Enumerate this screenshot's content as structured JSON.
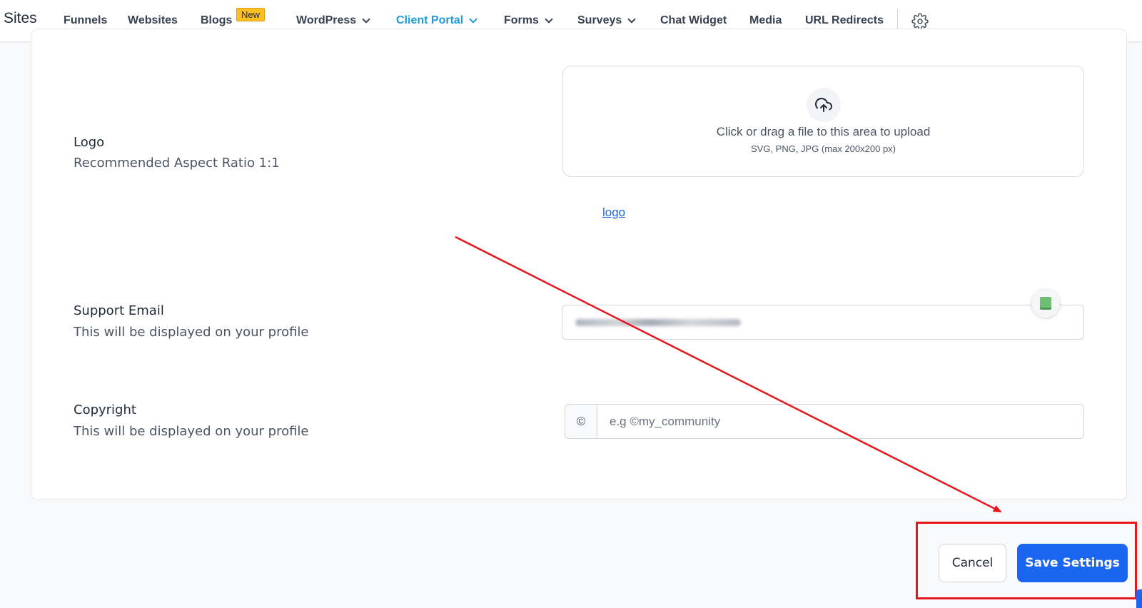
{
  "nav": {
    "brand": "Sites",
    "items": [
      {
        "label": "Funnels"
      },
      {
        "label": "Websites"
      },
      {
        "label": "Blogs"
      },
      {
        "label": "WordPress"
      },
      {
        "label": "Client Portal"
      },
      {
        "label": "Forms"
      },
      {
        "label": "Surveys"
      },
      {
        "label": "Chat Widget"
      },
      {
        "label": "Media"
      },
      {
        "label": "URL Redirects"
      }
    ],
    "new_badge": "New",
    "active_item": "Client Portal",
    "settings_icon": "gear-icon"
  },
  "form": {
    "logo": {
      "title": "Logo",
      "subtitle": "Recommended Aspect Ratio 1:1",
      "upload_text": "Click or drag a file to this area to upload",
      "upload_hint": "SVG, PNG, JPG (max 200x200 px)",
      "upload_icon": "cloud-upload-icon",
      "link_text": "logo"
    },
    "support_email": {
      "title": "Support Email",
      "subtitle": "This will be displayed on your profile"
    },
    "copyright": {
      "title": "Copyright",
      "subtitle": "This will be displayed on your profile",
      "addon": "©",
      "placeholder": "e.g ©my_community",
      "value": ""
    }
  },
  "actions": {
    "cancel_label": "Cancel",
    "save_label": "Save Settings"
  },
  "colors": {
    "accent": "#1d9bd6",
    "primary_button": "#1a66f0",
    "annotation_red": "#e8151b",
    "badge": "#fbbf24"
  }
}
